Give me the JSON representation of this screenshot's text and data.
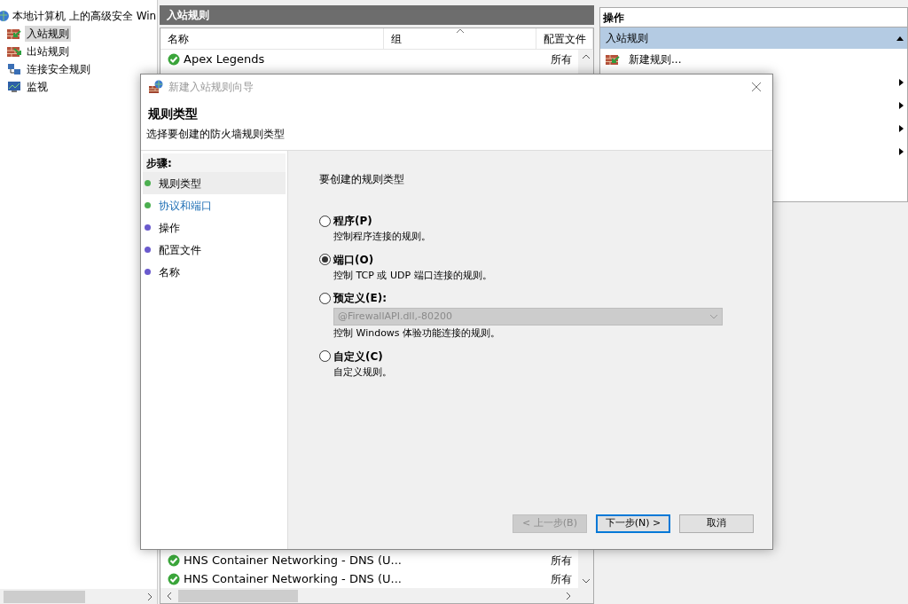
{
  "tree": {
    "root": "本地计算机 上的高级安全 Win",
    "children": [
      {
        "label": "入站规则",
        "selected": true,
        "kind": "inbound"
      },
      {
        "label": "出站规则",
        "selected": false,
        "kind": "outbound"
      },
      {
        "label": "连接安全规则",
        "selected": false,
        "kind": "security"
      },
      {
        "label": "监视",
        "selected": false,
        "kind": "monitor"
      }
    ]
  },
  "rules_panel": {
    "title": "入站规则",
    "columns": [
      "名称",
      "组",
      "配置文件"
    ],
    "top_rows": [
      {
        "name": "Apex Legends",
        "profile": "所有",
        "enabled": true
      }
    ],
    "bottom_rows": [
      {
        "name": "HNS Container Networking - DNS (U...",
        "profile": "所有",
        "enabled": true
      },
      {
        "name": "HNS Container Networking - DNS (U...",
        "profile": "所有",
        "enabled": true
      }
    ]
  },
  "actions_panel": {
    "title": "操作",
    "section": "入站规则",
    "items": [
      {
        "label": "新建规则..."
      }
    ]
  },
  "dialog": {
    "title": "新建入站规则向导",
    "heading": "规则类型",
    "subheading": "选择要创建的防火墙规则类型",
    "steps_label": "步骤:",
    "steps": [
      {
        "label": "规则类型",
        "selected": true,
        "highlighted": false,
        "color": "#4caf50"
      },
      {
        "label": "协议和端口",
        "selected": false,
        "highlighted": true,
        "color": "#4caf50"
      },
      {
        "label": "操作",
        "selected": false,
        "highlighted": false,
        "color": "#6a5acd"
      },
      {
        "label": "配置文件",
        "selected": false,
        "highlighted": false,
        "color": "#6a5acd"
      },
      {
        "label": "名称",
        "selected": false,
        "highlighted": false,
        "color": "#6a5acd"
      }
    ],
    "prompt": "要创建的规则类型",
    "options": [
      {
        "label": "程序(P)",
        "description": "控制程序连接的规则。",
        "selected": false
      },
      {
        "label": "端口(O)",
        "description": "控制 TCP 或 UDP 端口连接的规则。",
        "selected": true
      },
      {
        "label": "预定义(E):",
        "dropdown": {
          "value": "@FirewallAPI.dll,-80200",
          "disabled": true
        },
        "description": "控制 Windows 体验功能连接的规则。",
        "selected": false
      },
      {
        "label": "自定义(C)",
        "description": "自定义规则。",
        "selected": false
      }
    ],
    "buttons": [
      {
        "label": "< 上一步(B)",
        "disabled": true,
        "default": false
      },
      {
        "label": "下一步(N) >",
        "disabled": false,
        "default": true
      },
      {
        "label": "取消",
        "disabled": false,
        "default": false
      }
    ]
  }
}
